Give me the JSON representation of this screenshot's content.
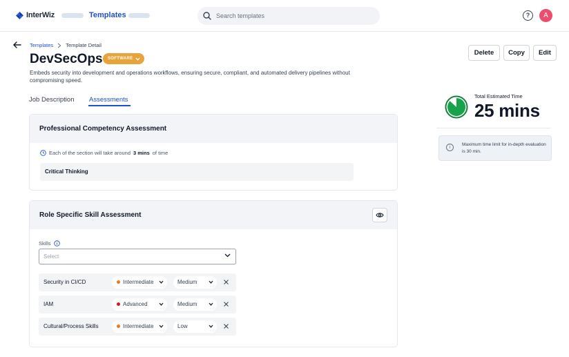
{
  "app": {
    "logo_text": "InterWiz"
  },
  "nav": {
    "active_label": "Templates"
  },
  "search": {
    "placeholder": "Search templates"
  },
  "user": {
    "avatar_initial": "A"
  },
  "breadcrumb": {
    "parent": "Templates",
    "current": "Template Detail"
  },
  "template": {
    "title": "DevSecOps",
    "badge": "SOFTWARE",
    "description": "Embeds security into development and operations workflows, ensuring secure, compliant, and automated delivery pipelines without compromising speed."
  },
  "actions": {
    "delete": "Delete",
    "copy": "Copy",
    "edit": "Edit"
  },
  "tabs": [
    {
      "label": "Job Description",
      "active": false
    },
    {
      "label": "Assessments",
      "active": true
    }
  ],
  "professional": {
    "title": "Professional Competency Assessment",
    "note_prefix": "Each of the section will take around",
    "note_value": "3 mins",
    "note_suffix": "of time",
    "sections": [
      "Critical Thinking"
    ]
  },
  "role_specific": {
    "title": "Role Specific Skill Assessment",
    "skills_label": "Skills",
    "select_placeholder": "Select",
    "skills": [
      {
        "name": "Security in CI/CD",
        "level": "Intermediate",
        "level_color": "#e07b2a",
        "difficulty": "Medium"
      },
      {
        "name": "IAM",
        "level": "Advanced",
        "level_color": "#c81e1e",
        "difficulty": "Medium"
      },
      {
        "name": "Cultural/Process Skills",
        "level": "Intermediate",
        "level_color": "#e07b2a",
        "difficulty": "Low"
      }
    ]
  },
  "summary": {
    "time_label": "Total Estimated Time",
    "time_value": "25 mins",
    "info_text": "Maximum time limit for in-depth evaluation is 30 min."
  },
  "colors": {
    "accent": "#1d4ed8",
    "badge": "#e8a33a",
    "ring": "#16a34a",
    "avatar": "#ec4d6c"
  }
}
